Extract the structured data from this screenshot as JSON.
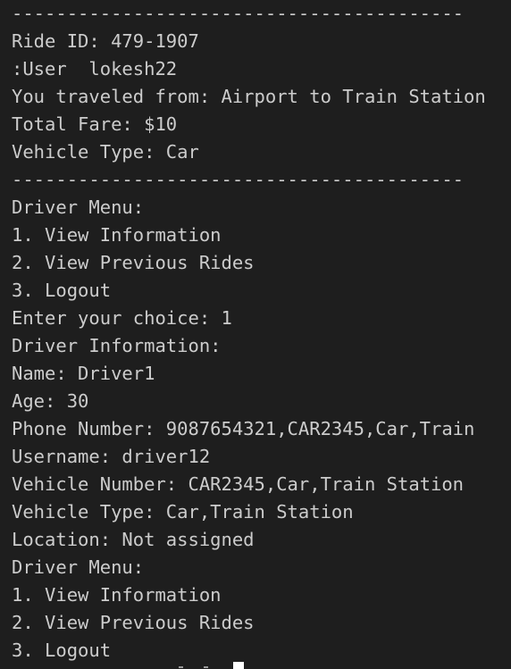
{
  "terminal": {
    "lines": [
      "-----------------------------------------",
      "Ride ID: 479-1907",
      ":User  lokesh22",
      "You traveled from: Airport to Train Station",
      "Total Fare: $10",
      "Vehicle Type: Car",
      "-----------------------------------------",
      "Driver Menu:",
      "1. View Information",
      "2. View Previous Rides",
      "3. Logout",
      "Enter your choice: 1",
      "Driver Information:",
      "Name: Driver1",
      "Age: 30",
      "Phone Number: 9087654321,CAR2345,Car,Train",
      "Username: driver12",
      "Vehicle Number: CAR2345,Car,Train Station",
      "Vehicle Type: Car,Train Station",
      "Location: Not assigned",
      "Driver Menu:",
      "1. View Information",
      "2. View Previous Rides",
      "3. Logout"
    ]
  }
}
